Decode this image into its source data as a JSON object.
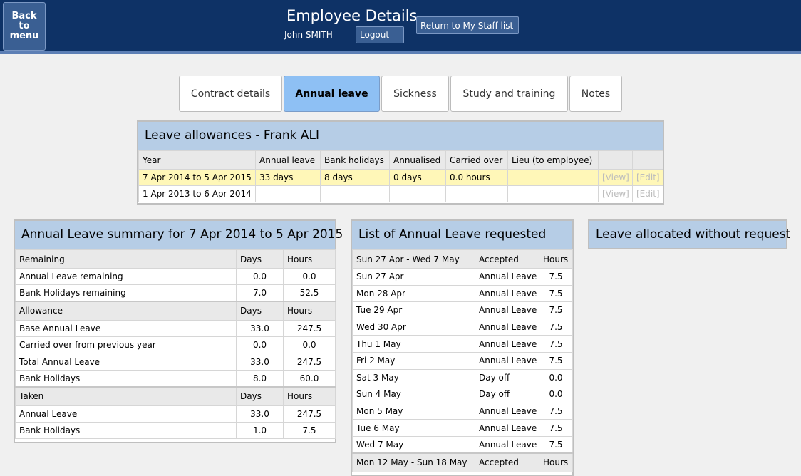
{
  "header": {
    "back_label": "Back\nto\nmenu",
    "title": "Employee Details",
    "user": "John SMITH",
    "logout_label": "Logout",
    "return_label": "Return to My Staff list"
  },
  "tabs": [
    {
      "label": "Contract details"
    },
    {
      "label": "Annual leave"
    },
    {
      "label": "Sickness"
    },
    {
      "label": "Study and training"
    },
    {
      "label": "Notes"
    }
  ],
  "allowances": {
    "title": "Leave allowances - Frank ALI",
    "columns": [
      "Year",
      "Annual leave",
      "Bank holidays",
      "Annualised",
      "Carried over",
      "Lieu (to employee)"
    ],
    "rows": [
      {
        "year": "7 Apr 2014 to 5 Apr 2015",
        "annual": "33 days",
        "bank": "8 days",
        "annualised": "0 days",
        "carried": "0.0 hours",
        "lieu": "",
        "view": "[View]",
        "edit": "[Edit]"
      },
      {
        "year": "1 Apr 2013 to 6 Apr 2014",
        "annual": "",
        "bank": "",
        "annualised": "",
        "carried": "",
        "lieu": "",
        "view": "[View]",
        "edit": "[Edit]"
      }
    ]
  },
  "summary": {
    "title": "Annual Leave summary for 7 Apr 2014 to 5 Apr 2015",
    "days_label": "Days",
    "hours_label": "Hours",
    "sections": [
      {
        "heading": "Remaining",
        "rows": [
          {
            "label": "Annual Leave remaining",
            "days": "0.0",
            "hours": "0.0"
          },
          {
            "label": "Bank Holidays remaining",
            "days": "7.0",
            "hours": "52.5"
          }
        ]
      },
      {
        "heading": "Allowance",
        "rows": [
          {
            "label": "Base Annual Leave",
            "days": "33.0",
            "hours": "247.5"
          },
          {
            "label": "Carried over from previous year",
            "days": "0.0",
            "hours": "0.0"
          },
          {
            "label": "Total Annual Leave",
            "days": "33.0",
            "hours": "247.5"
          },
          {
            "label": "Bank Holidays",
            "days": "8.0",
            "hours": "60.0"
          }
        ]
      },
      {
        "heading": "Taken",
        "rows": [
          {
            "label": "Annual Leave",
            "days": "33.0",
            "hours": "247.5"
          },
          {
            "label": "Bank Holidays",
            "days": "1.0",
            "hours": "7.5"
          }
        ]
      }
    ]
  },
  "requested": {
    "title": "List of Annual Leave requested",
    "accepted_label": "Accepted",
    "hours_label": "Hours",
    "groups": [
      {
        "period": "Sun 27 Apr - Wed 7 May",
        "rows": [
          {
            "date": "Sun 27 Apr",
            "type": "Annual Leave",
            "hours": "7.5"
          },
          {
            "date": "Mon 28 Apr",
            "type": "Annual Leave",
            "hours": "7.5"
          },
          {
            "date": "Tue 29 Apr",
            "type": "Annual Leave",
            "hours": "7.5"
          },
          {
            "date": "Wed 30 Apr",
            "type": "Annual Leave",
            "hours": "7.5"
          },
          {
            "date": "Thu 1 May",
            "type": "Annual Leave",
            "hours": "7.5"
          },
          {
            "date": "Fri 2 May",
            "type": "Annual Leave",
            "hours": "7.5"
          },
          {
            "date": "Sat 3 May",
            "type": "Day off",
            "hours": "0.0"
          },
          {
            "date": "Sun 4 May",
            "type": "Day off",
            "hours": "0.0"
          },
          {
            "date": "Mon 5 May",
            "type": "Annual Leave",
            "hours": "7.5"
          },
          {
            "date": "Tue 6 May",
            "type": "Annual Leave",
            "hours": "7.5"
          },
          {
            "date": "Wed 7 May",
            "type": "Annual Leave",
            "hours": "7.5"
          }
        ]
      },
      {
        "period": "Mon 12 May - Sun 18 May",
        "rows": []
      }
    ]
  },
  "allocated": {
    "title": "Leave allocated without request"
  }
}
